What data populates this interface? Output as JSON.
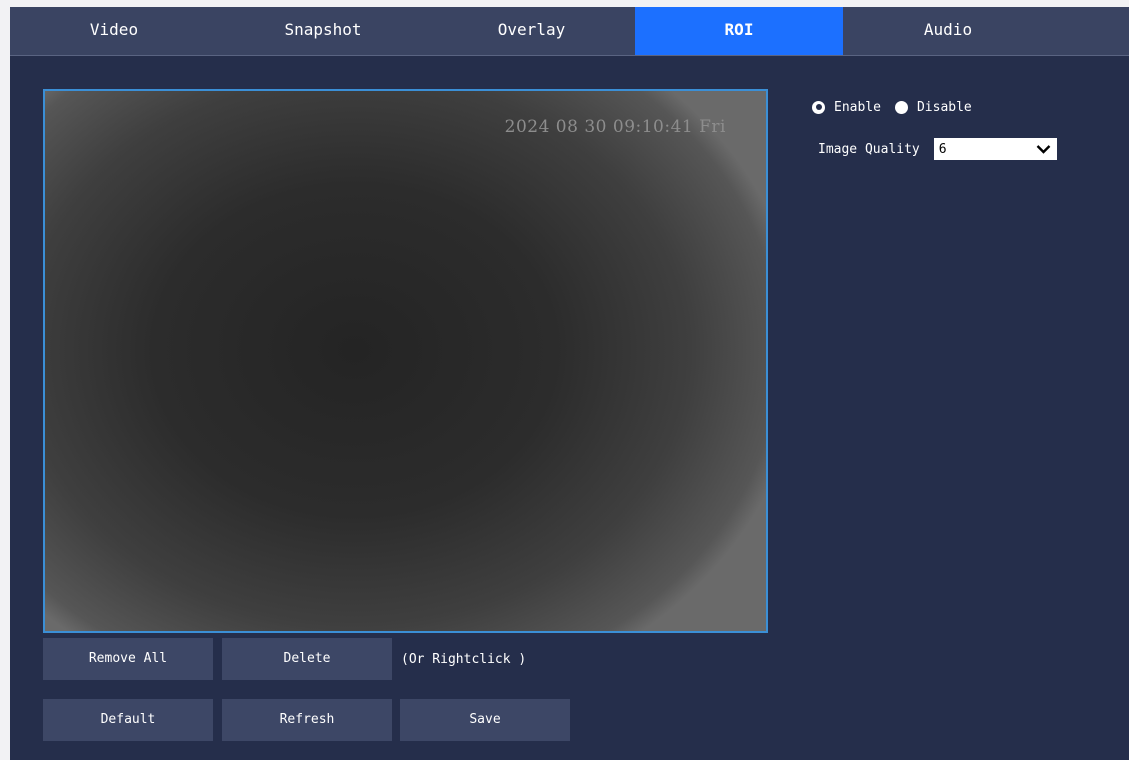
{
  "tabs": [
    {
      "label": "Video",
      "active": false
    },
    {
      "label": "Snapshot",
      "active": false
    },
    {
      "label": "Overlay",
      "active": false
    },
    {
      "label": "ROI",
      "active": true
    },
    {
      "label": "Audio",
      "active": false
    }
  ],
  "preview": {
    "osd_timestamp": "2024 08 30 09:10:41 Fri"
  },
  "roi": {
    "enable_label": "Enable",
    "disable_label": "Disable",
    "selected": "Enable",
    "image_quality_label": "Image Quality",
    "image_quality_value": "6"
  },
  "buttons": {
    "remove_all": "Remove All",
    "delete": "Delete",
    "hint": "(Or Rightclick )",
    "default": "Default",
    "refresh": "Refresh",
    "save": "Save"
  },
  "colors": {
    "accent": "#1c70ff",
    "panel_bg": "#252e4b",
    "button_bg": "#3d4766"
  }
}
